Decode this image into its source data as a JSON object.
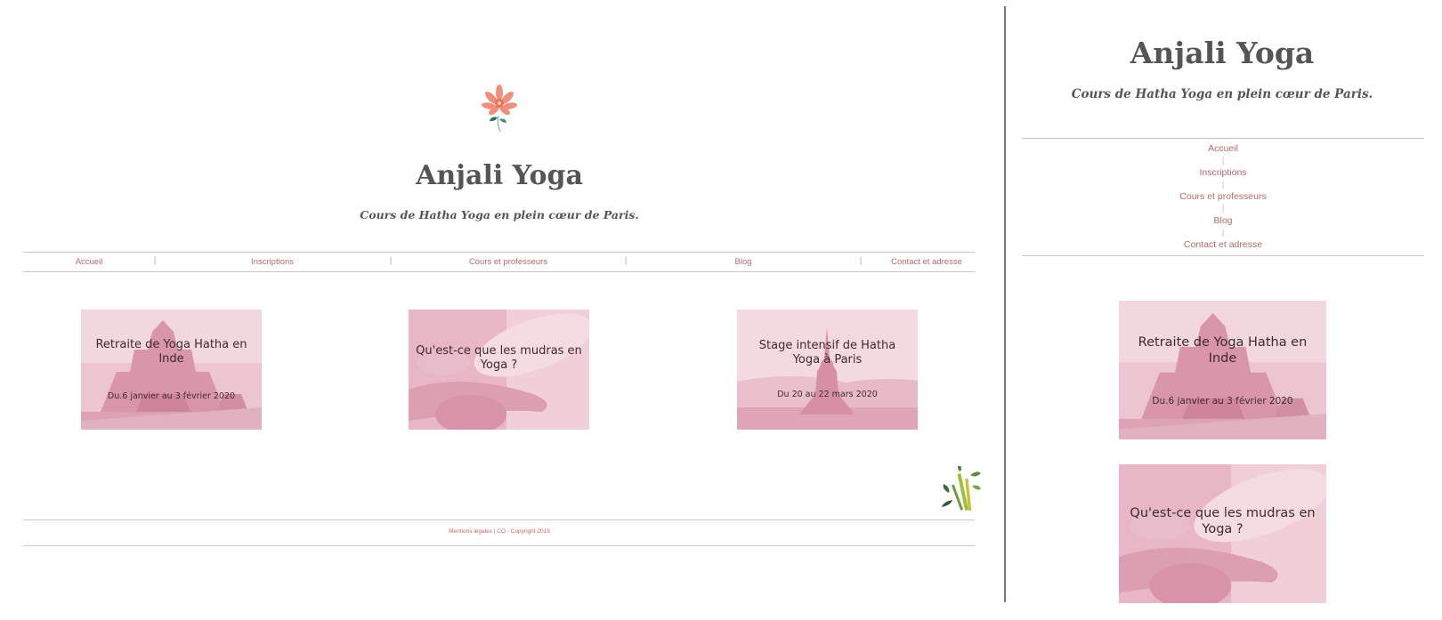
{
  "site": {
    "title": "Anjali Yoga",
    "subtitle": "Cours de Hatha Yoga en plein cœur de Paris."
  },
  "nav": {
    "items": [
      "Accueil",
      "Inscriptions",
      "Cours et professeurs",
      "Blog",
      "Contact et adresse"
    ],
    "separator": "|"
  },
  "cards": [
    {
      "title": "Retraite de Yoga Hatha en Inde",
      "date": "Du.6 janvier au 3 février 2020",
      "image": "temple"
    },
    {
      "title": "Qu'est-ce que les mudras en Yoga ?",
      "date": "",
      "image": "meditation-hands"
    },
    {
      "title": "Stage intensif de Hatha Yoga à Paris",
      "date": "Du 20 au 22 mars 2020",
      "image": "yoga-silhouette"
    }
  ],
  "footer": {
    "text": "Mentions légales | CO - Copyright 2019"
  },
  "icons": {
    "logo": "lotus-flower-icon",
    "decoration": "bamboo-icon"
  },
  "colors": {
    "accent": "#b46a6a",
    "card_tint": "#e3a8b8",
    "title": "#555555",
    "card_text": "#3e2a2f"
  }
}
